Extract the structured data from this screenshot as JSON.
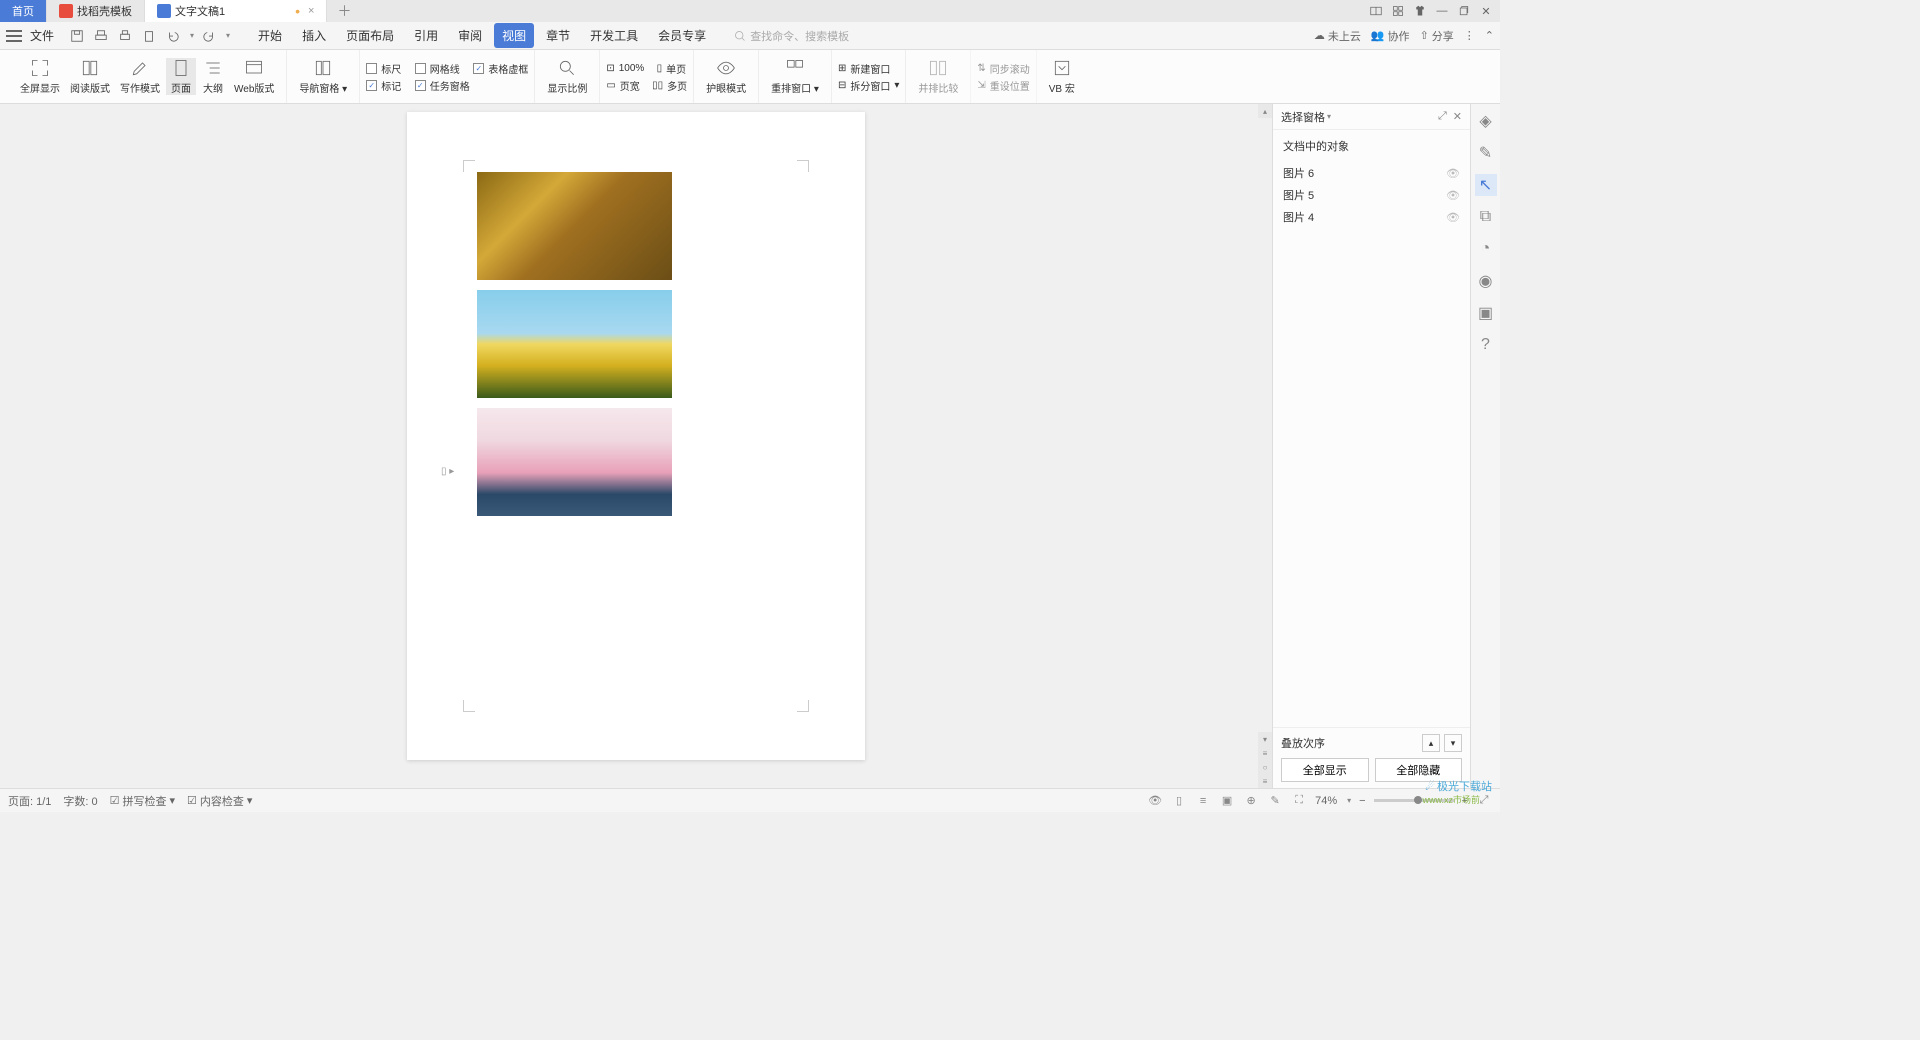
{
  "titlebar": {
    "home": "首页",
    "template_tab": "找稻壳模板",
    "doc_tab": "文字文稿1"
  },
  "menubar": {
    "file": "文件",
    "tabs": [
      "开始",
      "插入",
      "页面布局",
      "引用",
      "审阅",
      "视图",
      "章节",
      "开发工具",
      "会员专享"
    ],
    "active_tab": "视图",
    "search_placeholder": "查找命令、搜索模板",
    "cloud": "未上云",
    "collab": "协作",
    "share": "分享"
  },
  "ribbon": {
    "fullscreen": "全屏显示",
    "read": "阅读版式",
    "write": "写作模式",
    "page": "页面",
    "outline": "大纲",
    "web": "Web版式",
    "navpane": "导航窗格",
    "ruler": "标尺",
    "gridlines": "网格线",
    "tableframe": "表格虚框",
    "markup": "标记",
    "taskpane": "任务窗格",
    "zoom": "显示比例",
    "pct100": "100%",
    "pagewidth": "页宽",
    "single": "单页",
    "multi": "多页",
    "eyecare": "护眼模式",
    "arrange": "重排窗口",
    "newwin": "新建窗口",
    "split": "拆分窗口",
    "compare": "并排比较",
    "syncscroll": "同步滚动",
    "resetpos": "重设位置",
    "vbmacro": "VB 宏"
  },
  "panel": {
    "title": "选择窗格",
    "subtitle": "文档中的对象",
    "items": [
      "图片 6",
      "图片 5",
      "图片 4"
    ],
    "stack_order": "叠放次序",
    "show_all": "全部显示",
    "hide_all": "全部隐藏"
  },
  "statusbar": {
    "page": "页面: 1/1",
    "words": "字数: 0",
    "spellcheck": "拼写检查",
    "contentcheck": "内容检查",
    "zoom": "74%"
  },
  "watermark": {
    "brand": "极光下载站",
    "url": "www.xz市场前"
  }
}
